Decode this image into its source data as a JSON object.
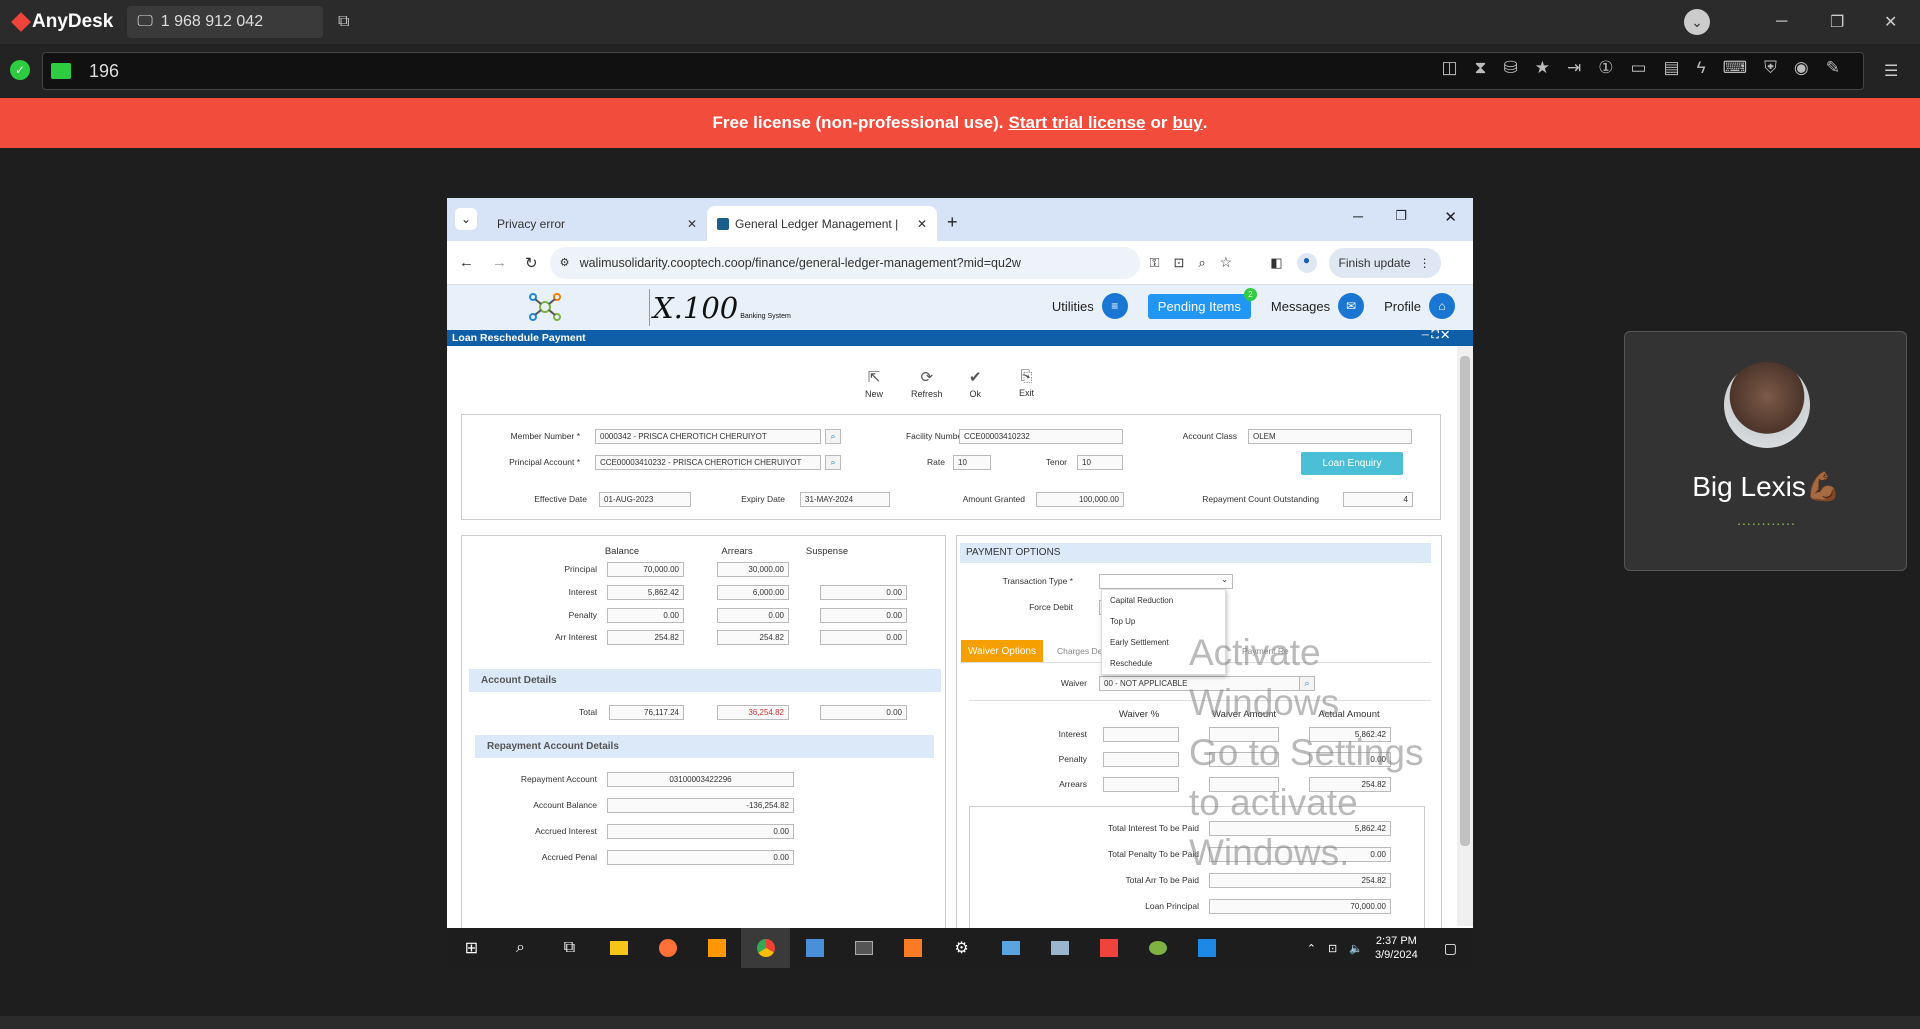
{
  "anydesk": {
    "app_name": "AnyDesk",
    "session_id": "1 968 912 042",
    "address": "196",
    "banner": {
      "text": "Free license (non-professional use).",
      "trial_link": "Start trial license",
      "or": "or",
      "buy_link": "buy",
      "dot": "."
    }
  },
  "browser": {
    "tabs": [
      {
        "label": "Privacy error"
      },
      {
        "label": "General Ledger Management |"
      }
    ],
    "url": "walimusolidarity.cooptech.coop/finance/general-ledger-management?mid=qu2w",
    "finish_update": "Finish update"
  },
  "app": {
    "brand": "X.100",
    "brand_sub": "Banking System",
    "nav": {
      "utilities": "Utilities",
      "pending": "Pending Items",
      "pending_count": "2",
      "messages": "Messages",
      "profile": "Profile"
    },
    "panel_title": "Loan Reschedule Payment",
    "toolbar": {
      "new": "New",
      "refresh": "Refresh",
      "ok": "Ok",
      "exit": "Exit"
    },
    "header_form": {
      "member_number_label": "Member Number *",
      "member_number": "0000342 - PRISCA CHEROTICH CHERUIYOT",
      "principal_account_label": "Principal Account *",
      "principal_account": "CCE00003410232 - PRISCA CHEROTICH CHERUIYOT",
      "facility_number_label": "Facility Number",
      "facility_number": "CCE00003410232",
      "rate_label": "Rate",
      "rate": "10",
      "tenor_label": "Tenor",
      "tenor": "10",
      "account_class_label": "Account Class",
      "account_class": "OLEM",
      "loan_enquiry": "Loan Enquiry",
      "effective_date_label": "Effective Date",
      "effective_date": "01-AUG-2023",
      "expiry_date_label": "Expiry Date",
      "expiry_date": "31-MAY-2024",
      "amount_granted_label": "Amount Granted",
      "amount_granted": "100,000.00",
      "repayment_count_label": "Repayment Count Outstanding",
      "repayment_count": "4"
    },
    "balances": {
      "col_balance": "Balance",
      "col_arrears": "Arrears",
      "col_suspense": "Suspense",
      "rows": [
        {
          "label": "Principal",
          "balance": "70,000.00",
          "arrears": "30,000.00",
          "suspense": ""
        },
        {
          "label": "Interest",
          "balance": "5,862.42",
          "arrears": "6,000.00",
          "suspense": "0.00"
        },
        {
          "label": "Penalty",
          "balance": "0.00",
          "arrears": "0.00",
          "suspense": "0.00"
        },
        {
          "label": "Arr Interest",
          "balance": "254.82",
          "arrears": "254.82",
          "suspense": "0.00"
        }
      ],
      "account_details": "Account Details",
      "total_label": "Total",
      "total_balance": "76,117.24",
      "total_arrears": "36,254.82",
      "total_suspense": "0.00",
      "arrears_color": "#d32f2f"
    },
    "repayment": {
      "title": "Repayment Account Details",
      "account_label": "Repayment Account",
      "account": "03100003422296",
      "balance_label": "Account Balance",
      "balance": "-136,254.82",
      "accrued_interest_label": "Accrued Interest",
      "accrued_interest": "0.00",
      "accrued_penal_label": "Accrued Penal",
      "accrued_penal": "0.00"
    },
    "payment": {
      "title": "PAYMENT OPTIONS",
      "transaction_type_label": "Transaction Type *",
      "force_debit_label": "Force Debit",
      "dropdown_options": [
        "Capital Reduction",
        "Top Up",
        "Early Settlement",
        "Reschedule"
      ],
      "tab_waiver": "Waiver Options",
      "tab_charges": "Charges De",
      "tab_payment": "Payment Re",
      "waiver_label": "Waiver",
      "waiver_value": "00 - NOT APPLICABLE",
      "col_waiver_pct": "Waiver %",
      "col_waiver_amt": "Waiver Amount",
      "col_actual_amt": "Actual Amount",
      "rows": [
        {
          "label": "Interest",
          "actual": "5,862.42"
        },
        {
          "label": "Penalty",
          "actual": "0.00"
        },
        {
          "label": "Arrears",
          "actual": "254.82"
        }
      ],
      "totals": [
        {
          "label": "Total Interest To be Paid",
          "value": "5,862.42"
        },
        {
          "label": "Total Penalty To be Paid",
          "value": "0.00"
        },
        {
          "label": "Total Arr To be Paid",
          "value": "254.82"
        },
        {
          "label": "Loan Principal",
          "value": "70,000.00"
        }
      ],
      "accent": "#f5a000"
    },
    "watermark": [
      "Activate",
      "Windows",
      "Go to Settings",
      "to activate",
      "Windows."
    ]
  },
  "taskbar": {
    "time": "2:37 PM",
    "date": "3/9/2024"
  },
  "video": {
    "name": "Big Lexis💪🏾",
    "dots": "............"
  }
}
